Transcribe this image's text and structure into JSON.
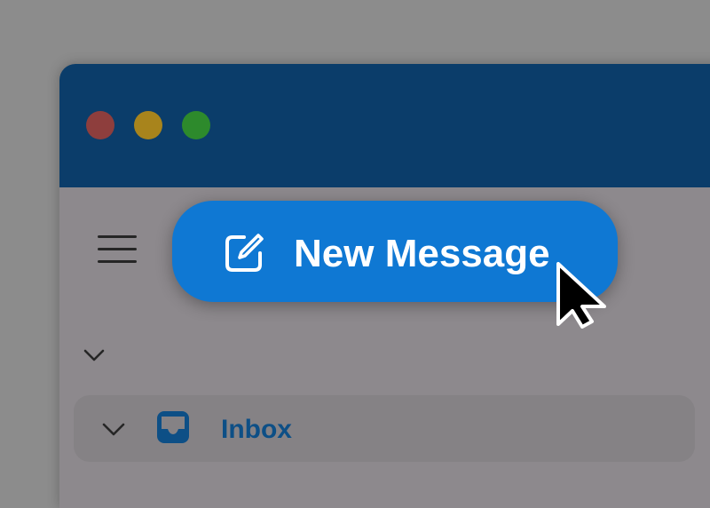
{
  "window": {
    "titlebar_color": "#0b3d6a",
    "traffic_lights": [
      {
        "name": "close",
        "color": "#8e3e3d"
      },
      {
        "name": "minimize",
        "color": "#a8841c"
      },
      {
        "name": "zoom",
        "color": "#2d8a2c"
      }
    ]
  },
  "toolbar": {
    "menu_icon": "hamburger-icon",
    "new_message_label": "New Message",
    "new_message_icon": "compose-icon",
    "accent_color": "#0f78d3"
  },
  "sidebar": {
    "section_chevron": "chevron-down-icon",
    "folders": [
      {
        "label": "Inbox",
        "icon": "inbox-icon",
        "color": "#0d4f86"
      }
    ]
  },
  "cursor": "arrow-pointer"
}
